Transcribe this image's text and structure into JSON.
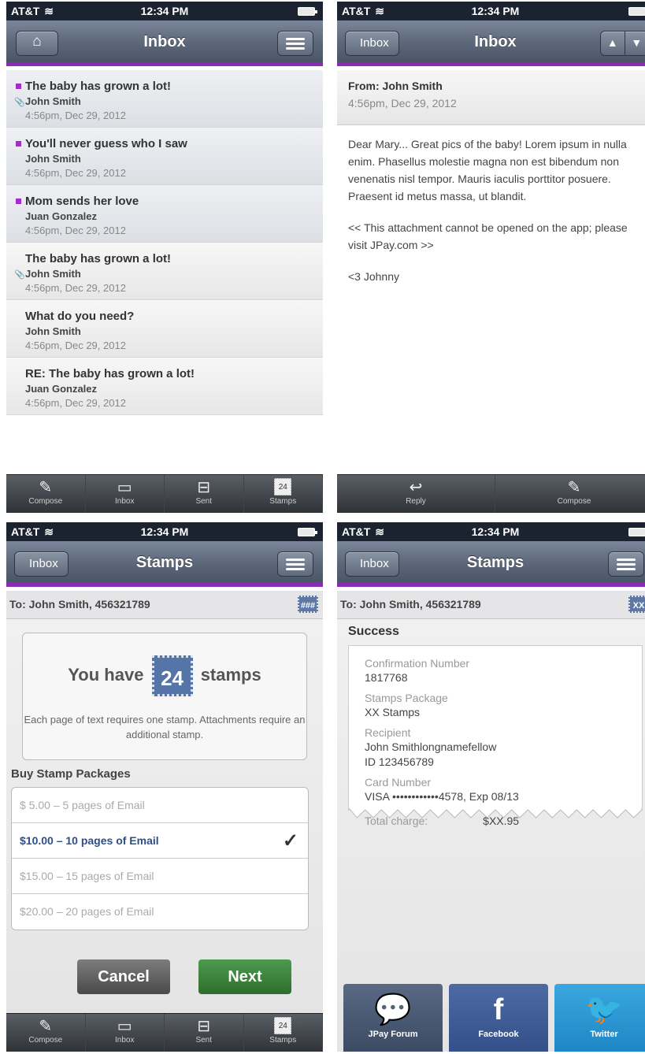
{
  "status": {
    "carrier": "AT&T",
    "time": "12:34 PM"
  },
  "inbox": {
    "title": "Inbox",
    "messages": [
      {
        "subject": "The baby has grown a lot!",
        "from": "John Smith",
        "date": "4:56pm, Dec 29, 2012"
      },
      {
        "subject": "You'll never guess who I saw",
        "from": "John Smith",
        "date": "4:56pm, Dec 29, 2012"
      },
      {
        "subject": "Mom sends her love",
        "from": "Juan Gonzalez",
        "date": "4:56pm, Dec 29, 2012"
      },
      {
        "subject": "The baby has grown a lot!",
        "from": "John Smith",
        "date": "4:56pm, Dec 29, 2012"
      },
      {
        "subject": "What do you need?",
        "from": "John Smith",
        "date": "4:56pm, Dec 29, 2012"
      },
      {
        "subject": "RE: The baby has grown a lot!",
        "from": "Juan Gonzalez",
        "date": "4:56pm, Dec 29, 2012"
      }
    ],
    "tabs": {
      "compose": "Compose",
      "inbox": "Inbox",
      "sent": "Sent",
      "stamps": "Stamps",
      "stamp_count": "24"
    }
  },
  "message": {
    "back": "Inbox",
    "title": "Inbox",
    "from": "From: John Smith",
    "date": "4:56pm, Dec 29, 2012",
    "body1": "Dear Mary... Great pics of the baby! Lorem ipsum in nulla enim. Phasellus molestie magna non est bibendum non venenatis nisl tempor. Mauris iaculis porttitor posuere. Praesent id metus massa, ut blandit.",
    "body2": "<< This attachment cannot be opened on the app; please visit JPay.com >>",
    "body3": "<3 Johnny",
    "tabs": {
      "reply": "Reply",
      "compose": "Compose"
    }
  },
  "stamps": {
    "back": "Inbox",
    "title": "Stamps",
    "to": "To: John Smith, 456321789",
    "mini": "###",
    "you_have": "You have",
    "count": "24",
    "stamps_word": "stamps",
    "note": "Each page of text requires one stamp. Attachments require an additional stamp.",
    "buy_title": "Buy Stamp Packages",
    "packages": [
      "$  5.00 –   5 pages of Email",
      "$10.00 – 10 pages of Email",
      "$15.00 – 15 pages of Email",
      "$20.00 – 20 pages of Email"
    ],
    "cancel": "Cancel",
    "next": "Next"
  },
  "success": {
    "back": "Inbox",
    "title": "Stamps",
    "to": "To: John Smith, 456321789",
    "mini": "XX",
    "heading": "Success",
    "conf_label": "Confirmation Number",
    "conf_value": "1817768",
    "pkg_label": "Stamps Package",
    "pkg_value": "XX Stamps",
    "recip_label": "Recipient",
    "recip_name": "John Smithlongnamefellow",
    "recip_id": "ID 123456789",
    "card_label": "Card Number",
    "card_value": "VISA ••••••••••••4578, Exp 08/13",
    "total_label": "Total charge:",
    "total_value": "$XX.95",
    "forum": "JPay Forum",
    "facebook": "Facebook",
    "twitter": "Twitter"
  }
}
